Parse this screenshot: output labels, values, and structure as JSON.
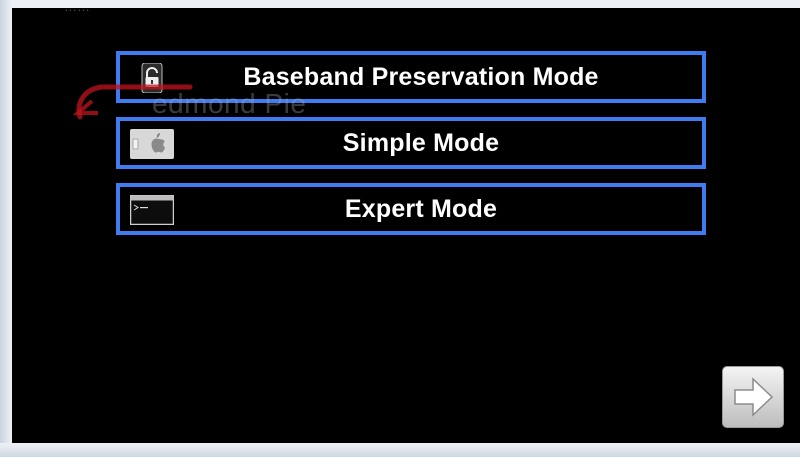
{
  "header": {
    "title_fragment": "……"
  },
  "modes": [
    {
      "label": "Baseband Preservation Mode",
      "icon": "padlock-icon"
    },
    {
      "label": "Simple Mode",
      "icon": "apple-phone-icon"
    },
    {
      "label": "Expert Mode",
      "icon": "terminal-icon"
    }
  ],
  "watermark": {
    "text": "edmond Pie",
    "logo": "redmond-pie-logo"
  },
  "navigation": {
    "next_icon": "next-arrow-icon"
  },
  "colors": {
    "panel_background": "#000000",
    "button_border": "#3f7cf0",
    "button_text": "#ffffff",
    "watermark_red": "#c0141e"
  }
}
